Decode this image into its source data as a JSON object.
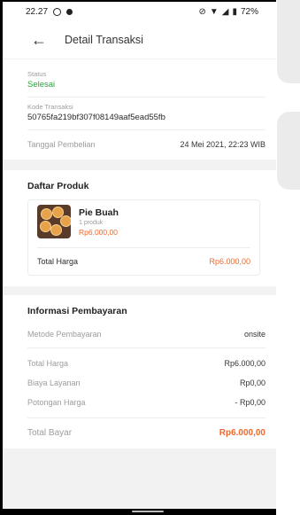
{
  "status_bar": {
    "time": "22.27",
    "battery": "72%"
  },
  "header": {
    "title": "Detail Transaksi"
  },
  "transaction": {
    "status_label": "Status",
    "status_value": "Selesai",
    "code_label": "Kode Transaksi",
    "code_value": "50765fa219bf307f08149aaf5ead55fb",
    "date_label": "Tanggal Pembelian",
    "date_value": "24 Mei 2021, 22:23 WIB"
  },
  "products": {
    "title": "Daftar Produk",
    "items": [
      {
        "name": "Pie Buah",
        "qty": "1 produk",
        "price": "Rp6.000,00"
      }
    ],
    "total_label": "Total Harga",
    "total_value": "Rp6.000,00"
  },
  "payment": {
    "title": "Informasi Pembayaran",
    "method_label": "Metode Pembayaran",
    "method_value": "onsite",
    "total_price_label": "Total Harga",
    "total_price_value": "Rp6.000,00",
    "service_fee_label": "Biaya Layanan",
    "service_fee_value": "Rp0,00",
    "discount_label": "Potongan Harga",
    "discount_value": "- Rp0,00",
    "grand_total_label": "Total Bayar",
    "grand_total_value": "Rp6.000,00"
  },
  "colors": {
    "success": "#2aa23a",
    "accent": "#f2682a"
  }
}
